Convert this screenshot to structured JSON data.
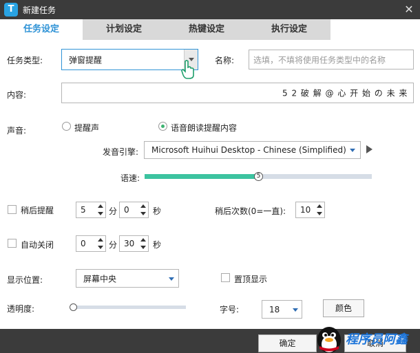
{
  "window": {
    "title": "新建任务",
    "logo": "T",
    "close": "✕"
  },
  "tabs": [
    {
      "label": "任务设定",
      "active": true
    },
    {
      "label": "计划设定",
      "active": false
    },
    {
      "label": "热键设定",
      "active": false
    },
    {
      "label": "执行设定",
      "active": false
    }
  ],
  "task": {
    "type_label": "任务类型:",
    "type_value": "弹窗提醒",
    "name_label": "名称:",
    "name_placeholder": "选填，不填将使用任务类型中的名称",
    "content_label": "内容:",
    "content_value": "5 2 破 解 @ 心 开 始 の 未 来"
  },
  "sound": {
    "label": "声音:",
    "option_beep": "提醒声",
    "option_tts": "语音朗读提醒内容",
    "selected": "tts",
    "engine_label": "发音引擎:",
    "engine_value": "Microsoft Huihui Desktop - Chinese (Simplified)",
    "speed_label": "语速:",
    "speed_value": 5,
    "speed_fraction": 0.5
  },
  "snooze": {
    "label": "稍后提醒",
    "checked": false,
    "minutes": "5",
    "min_unit": "分",
    "seconds": "0",
    "sec_unit": "秒",
    "count_label": "稍后次数(0=一直):",
    "count_value": "10"
  },
  "autoclose": {
    "label": "自动关闭",
    "checked": false,
    "minutes": "0",
    "min_unit": "分",
    "seconds": "30",
    "sec_unit": "秒"
  },
  "display": {
    "position_label": "显示位置:",
    "position_value": "屏幕中央",
    "topmost_label": "置顶显示",
    "opacity_label": "透明度:",
    "opacity_fraction": 0.0,
    "fontsize_label": "字号:",
    "fontsize_value": "18",
    "color_button": "颜色"
  },
  "footer": {
    "ok_button": "确定",
    "cancel_button": "取消",
    "watermark": "程序员阿鑫"
  },
  "colors": {
    "accent": "#2f93d6",
    "slider": "#3cc3a0",
    "titlebar": "#3b3b3b"
  }
}
